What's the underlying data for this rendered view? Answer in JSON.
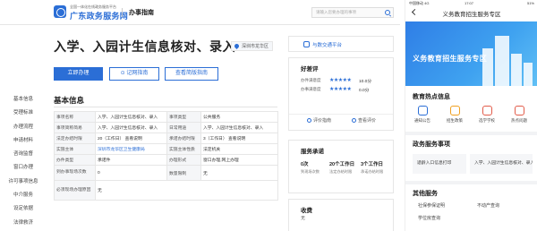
{
  "desktop": {
    "logo": {
      "sub": "全国一体化在线政务服务平台",
      "main": "广东政务服务网"
    },
    "nav_guide": "办事指南",
    "search_placeholder": "请输入您要办理的事项",
    "title": "入学、入园计生信息核对、录入",
    "location": "深圳市龙华区",
    "buttons": {
      "apply": "立即办理",
      "record": "⊙ 记网指南",
      "view": "查看简版指南"
    },
    "side_nav": [
      "基本信息",
      "受理标准",
      "办理流程",
      "申请材料",
      "咨询监督",
      "窗口办理",
      "许可事项信息",
      "中介服务",
      "设定依据",
      "法律救济"
    ],
    "section_title": "基本信息",
    "table": [
      [
        "事项名称",
        "入学、入园计生信息核对、录入",
        "事项类型",
        "公共服务"
      ],
      [
        "事项简称简易",
        "入学、入园计生信息核对、录入",
        "日常用途",
        "入学、入园计生信息核对、录入"
      ],
      [
        "法定办结时限",
        "20（工作日）  查看说明",
        "承诺办结时限",
        "3（工作日）  查看说明"
      ],
      [
        "实施主体",
        "深圳市龙华区卫生健康局",
        "实施主体性质",
        "法定机关"
      ],
      [
        "办件类型",
        "承诺件",
        "办理形式",
        "窗口办理,网上办理"
      ],
      [
        "到办事现场次数",
        "0",
        "数量限制",
        "无"
      ],
      [
        "必须现场办理原因",
        "无",
        "",
        ""
      ]
    ],
    "online_platform": "与数交通平台",
    "rating": {
      "title": "好差评",
      "rows": [
        {
          "label": "办件满意度",
          "stars": "★★★★★",
          "score": "10.0分"
        },
        {
          "label": "办事满意度",
          "stars": "★★★★★",
          "score": "0.0分"
        }
      ],
      "btn_eval": "评价指南",
      "btn_view": "查看评价"
    },
    "promise": {
      "title": "服务承诺",
      "items": [
        {
          "value": "0次",
          "label": "到现场次数"
        },
        {
          "value": "20个工作日",
          "label": "法定办结时限"
        },
        {
          "value": "3个工作日",
          "label": "承诺办结时限"
        }
      ]
    },
    "fees": {
      "title": "收费",
      "value": "无"
    }
  },
  "phone": {
    "status": {
      "left": "中国移动 4G",
      "time": "17:07",
      "right": "51%"
    },
    "title": "义务教育招生服务专区",
    "banner_title": "义务教育招生服务专区",
    "hot_title": "教育热点信息",
    "hot_items": [
      {
        "label": "通知公告",
        "color": "#2b6ed6"
      },
      {
        "label": "招生政策",
        "color": "#f0a020"
      },
      {
        "label": "选学学校",
        "color": "#e25c4a"
      },
      {
        "label": "热点问题",
        "color": "#e25c4a"
      }
    ],
    "services_title": "政务服务事项",
    "services": [
      "适龄入口信息打印",
      "入学、入园计生信息核对、录入"
    ],
    "other_title": "其他服务",
    "other_items": [
      "社保参保证明",
      "不动产查询",
      "学位房查询"
    ]
  }
}
